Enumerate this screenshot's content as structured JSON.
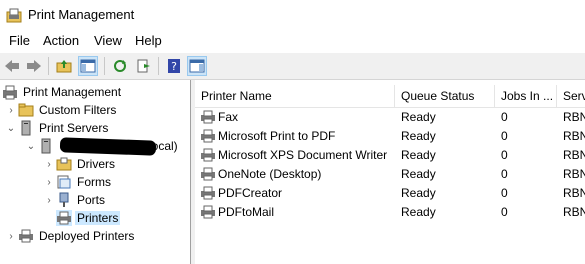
{
  "window": {
    "title": "Print Management",
    "icon": "printer-folder-icon"
  },
  "menu": [
    "File",
    "Action",
    "View",
    "Help"
  ],
  "toolbar": {
    "buttons": [
      "back-arrow-icon",
      "forward-arrow-icon",
      "up-folder-icon",
      "show-hide-tree-icon",
      "refresh-icon",
      "export-list-icon",
      "help-icon",
      "show-hide-action-pane-icon"
    ]
  },
  "tree": {
    "root": "Print Management",
    "items": [
      {
        "label": "Custom Filters",
        "icon": "filter-icon",
        "expander": "collapsed"
      },
      {
        "label": "Print Servers",
        "icon": "server-icon",
        "expander": "expanded"
      },
      {
        "label": "(local)",
        "icon": "server-icon",
        "expander": "expanded",
        "redacted": true
      },
      {
        "label": "Drivers",
        "icon": "drivers-icon",
        "expander": "collapsed"
      },
      {
        "label": "Forms",
        "icon": "forms-icon",
        "expander": "collapsed"
      },
      {
        "label": "Ports",
        "icon": "port-icon",
        "expander": "collapsed"
      },
      {
        "label": "Printers",
        "icon": "printer-icon",
        "expander": "none",
        "selected": true
      },
      {
        "label": "Deployed Printers",
        "icon": "deployed-printers-icon",
        "expander": "collapsed"
      }
    ]
  },
  "list": {
    "columns": [
      "Printer Name",
      "Queue Status",
      "Jobs In ...",
      "Serv"
    ],
    "rows": [
      {
        "name": "Fax",
        "status": "Ready",
        "jobs": "0",
        "server": "RBN"
      },
      {
        "name": "Microsoft Print to PDF",
        "status": "Ready",
        "jobs": "0",
        "server": "RBN"
      },
      {
        "name": "Microsoft XPS Document Writer",
        "status": "Ready",
        "jobs": "0",
        "server": "RBN"
      },
      {
        "name": "OneNote (Desktop)",
        "status": "Ready",
        "jobs": "0",
        "server": "RBN"
      },
      {
        "name": "PDFCreator",
        "status": "Ready",
        "jobs": "0",
        "server": "RBN"
      },
      {
        "name": "PDFtoMail",
        "status": "Ready",
        "jobs": "0",
        "server": "RBN"
      }
    ]
  },
  "colors": {
    "selection": "#cce8ff",
    "toolbar_bg": "#f0f0f0",
    "pressed_button": "#cce4f7"
  }
}
